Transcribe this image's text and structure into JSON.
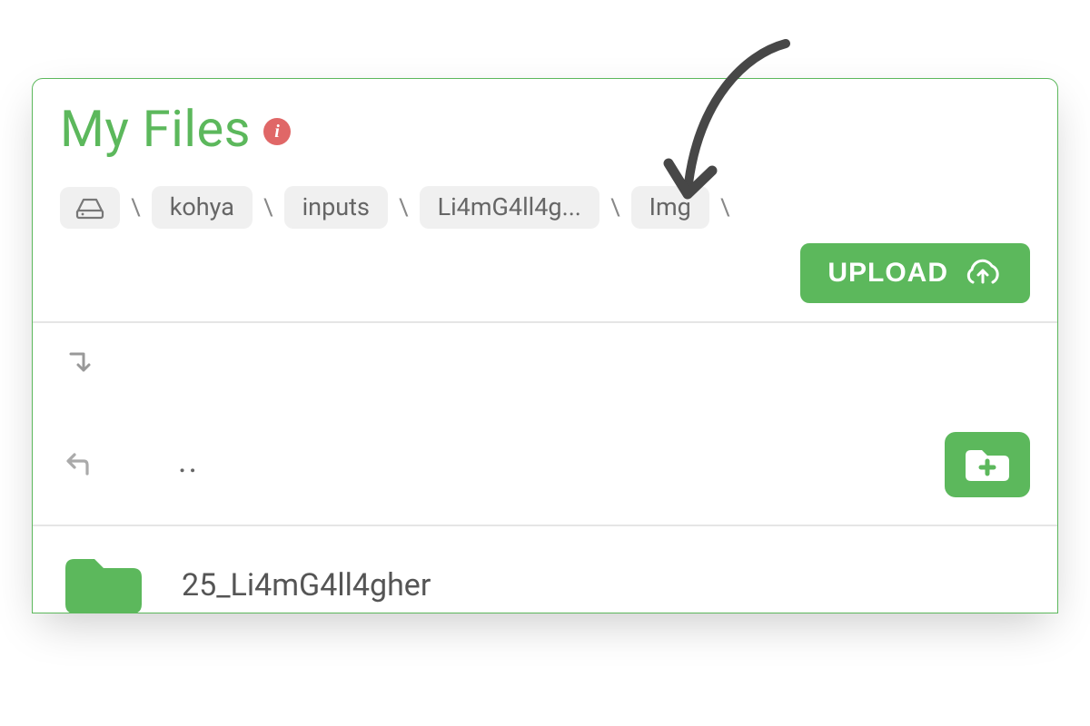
{
  "title": "My Files",
  "info_glyph": "i",
  "breadcrumb": {
    "sep": "\\",
    "items": [
      {
        "type": "icon",
        "name": "drive-icon"
      },
      {
        "type": "text",
        "label": "kohya"
      },
      {
        "type": "text",
        "label": "inputs"
      },
      {
        "type": "text",
        "label": "Li4mG4ll4g..."
      },
      {
        "type": "text",
        "label": "Img"
      }
    ]
  },
  "upload_label": "UPLOAD",
  "parent_label": "..",
  "folders": [
    {
      "name": "25_Li4mG4ll4gher"
    }
  ],
  "colors": {
    "accent": "#5cb85c",
    "info_badge": "#e06767"
  }
}
